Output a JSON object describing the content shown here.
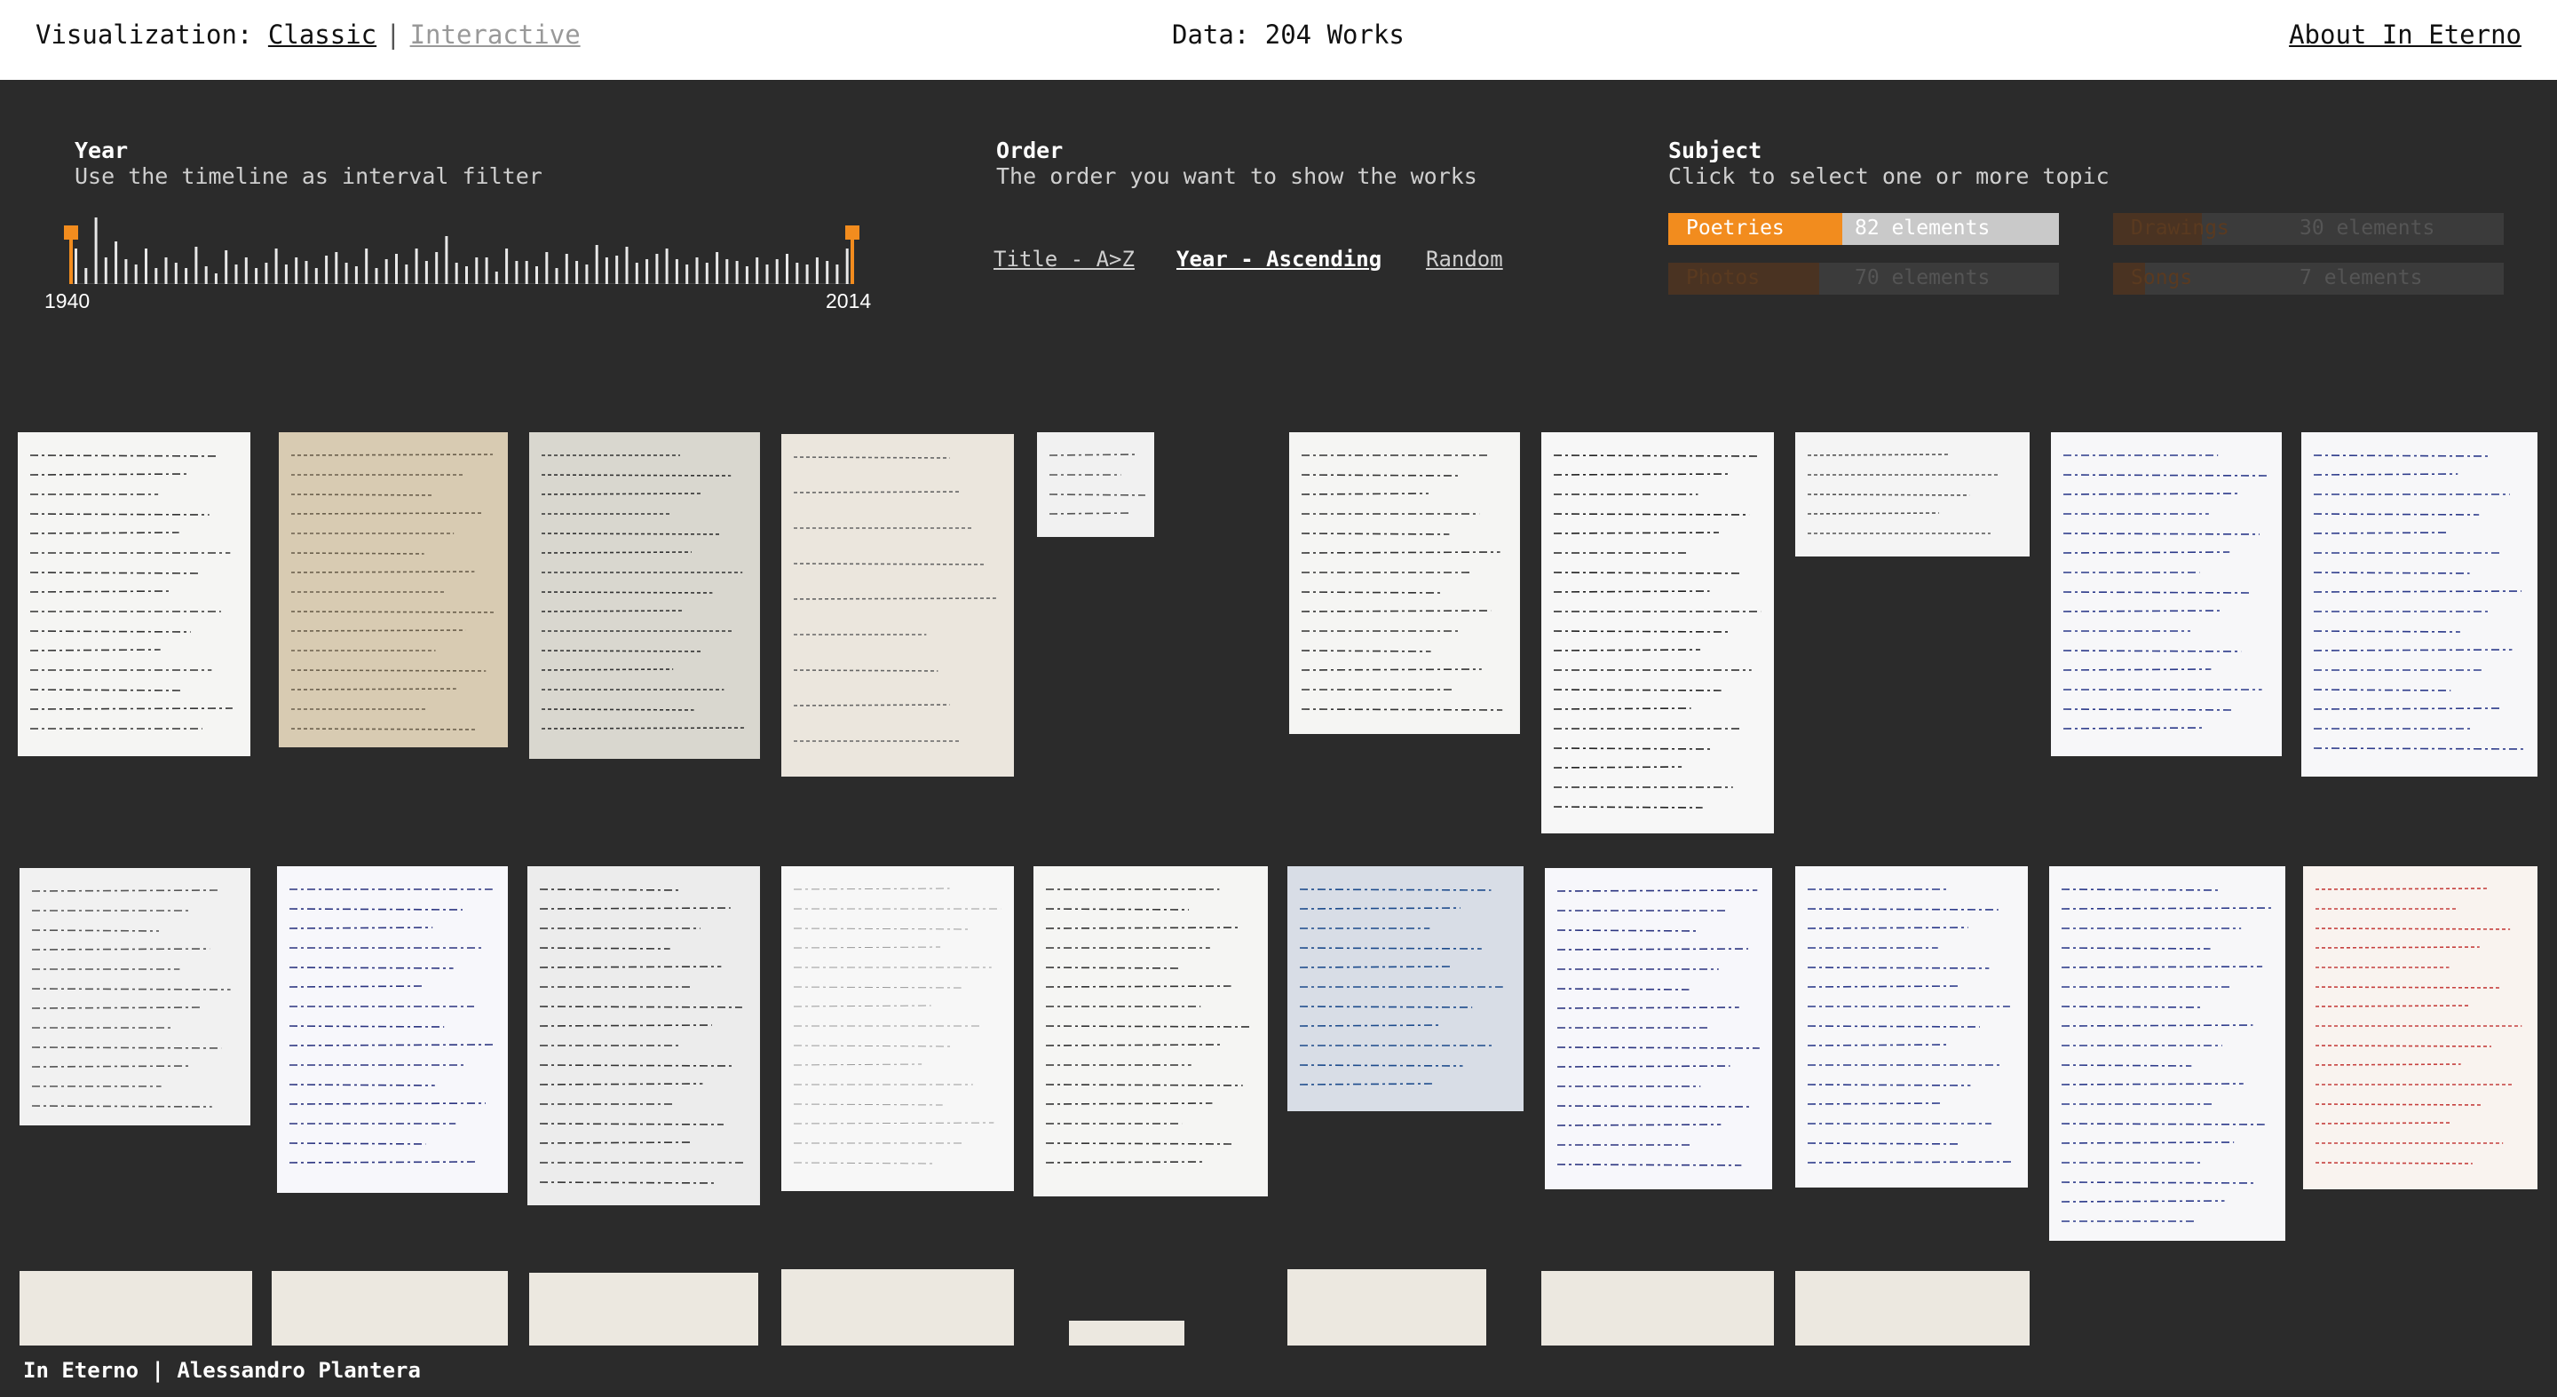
{
  "header": {
    "visualization_label": "Visualization:",
    "mode_classic": "Classic",
    "mode_separator": "|",
    "mode_interactive": "Interactive",
    "data_summary": "Data: 204 Works",
    "about_link": "About In Eterno"
  },
  "year_filter": {
    "title": "Year",
    "subtitle": "Use the timeline as interval filter",
    "start_year": "1940",
    "end_year": "2014",
    "accent_color": "#f28c1e"
  },
  "order": {
    "title": "Order",
    "subtitle": "The order you want to show the works",
    "options": [
      "Title - A>Z",
      "Year - Ascending",
      "Random"
    ],
    "selected": "Year - Ascending"
  },
  "subject": {
    "title": "Subject",
    "subtitle": "Click to select one or more topic",
    "topics": [
      {
        "name": "Poetries",
        "count_label": "82 elements",
        "active": true
      },
      {
        "name": "Drawings",
        "count_label": "30 elements",
        "active": false
      },
      {
        "name": "Photos",
        "count_label": "70 elements",
        "active": false
      },
      {
        "name": "Songs",
        "count_label": "7 elements",
        "active": false
      }
    ]
  },
  "works": {
    "item_kinds": [
      "handwritten-letter",
      "typed-form",
      "telegram",
      "typed-document",
      "small-note",
      "handwritten-letter",
      "handwritten-grid",
      "typed-note",
      "handwritten-blue",
      "handwritten-blue",
      "small-note",
      "handwritten-ruled",
      "calendar-page",
      "faint-letter",
      "handwritten-letter",
      "photo-ad",
      "handwritten-ruled",
      "handwritten-blue",
      "handwritten-blue",
      "typed-red"
    ]
  },
  "footer": {
    "credits": "In Eterno | Alessandro Plantera"
  }
}
